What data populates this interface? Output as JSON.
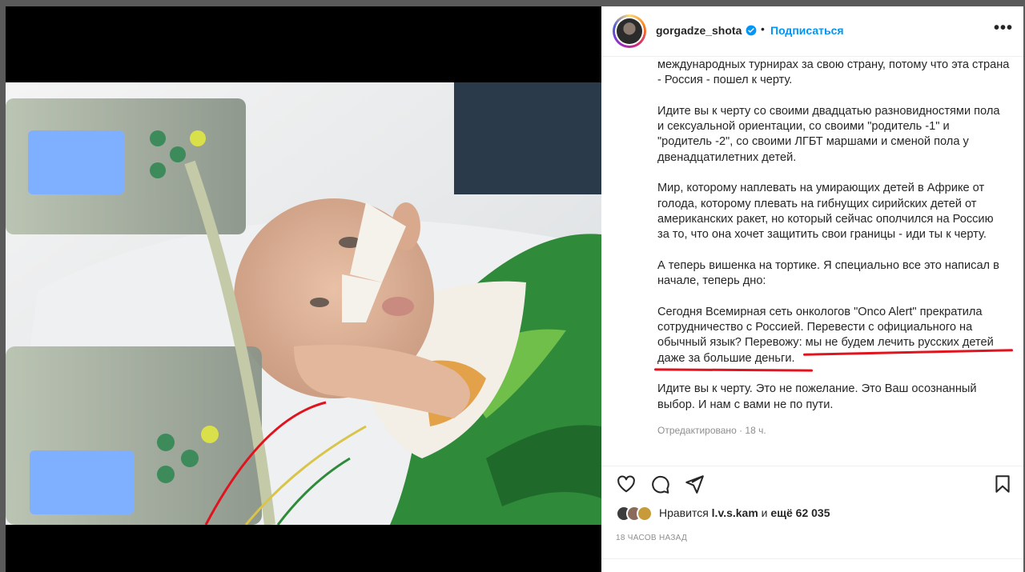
{
  "post": {
    "username": "gorgadze_shota",
    "follow_label": "Подписаться",
    "more_label": "•••",
    "caption_paragraphs": [
      "международных турнирах за свою страну, потому что эта страна\n- Россия - пошел к черту.",
      "Идите вы к черту со своими двадцатью разновидностями пола\nи сексуальной ориентации, со своими \"родитель -1\" и\n\"родитель -2\", со своими ЛГБТ маршами и сменой пола у\nдвенадцатилетних детей.",
      "Мир, которому наплевать на умирающих детей в Африке от\nголода, которому плевать на гибнущих сирийских детей от\nамериканских ракет, но который сейчас ополчился на Россию\nза то, что она хочет защитить свои границы - иди ты к черту.",
      "А теперь вишенка на тортике. Я специально все это написал в\nначале, теперь дно:",
      "Сегодня Всемирная сеть онкологов \"Onco Alert\" прекратила\nсотрудничество с Россией. Перевести с официального на\nобычный язык? Перевожу: мы не будем лечить русских детей\nдаже за большие деньги.",
      "Идите вы к черту. Это не пожелание. Это Ваш осознанный\nвыбор. И нам с вами не по пути."
    ],
    "edited_label": "Отредактировано · 18 ч.",
    "likes_prefix": "Нравится ",
    "likes_user": "l.v.s.kam",
    "likes_mid": " и ",
    "likes_count": "ещё 62 035",
    "time_ago": "18 ЧАСОВ НАЗАД"
  },
  "colors": {
    "accent": "#0095f6",
    "underline": "#e0141e",
    "text": "#262626",
    "muted": "#8e8e8e"
  },
  "icons": [
    "verified-badge-icon",
    "more-options-icon",
    "heart-icon",
    "comment-icon",
    "share-icon",
    "bookmark-icon"
  ]
}
